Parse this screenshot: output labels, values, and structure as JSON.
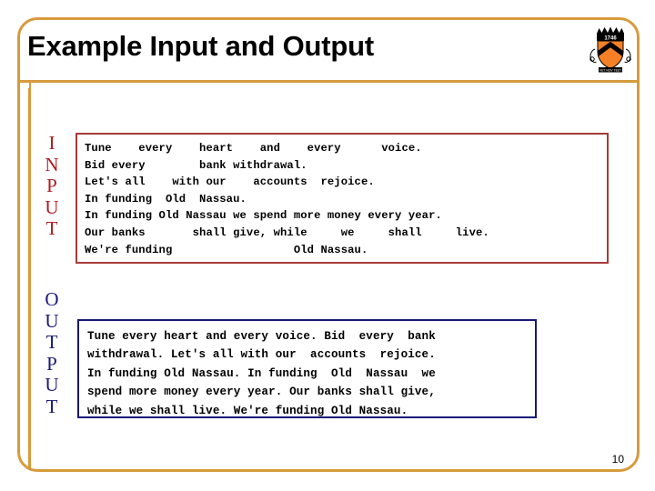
{
  "slide": {
    "title": "Example Input and Output",
    "page_number": "10",
    "frame_color": "#d79b3c",
    "background": "#ffffff"
  },
  "logo": {
    "name": "princeton-shield-logo",
    "shield_color": "#f58025",
    "chevron_color": "#000000",
    "crown_color": "#000000",
    "motto": "VET NOV TEST"
  },
  "input_section": {
    "label_color": "#b01c21",
    "label_letters": [
      "I",
      "N",
      "P",
      "U",
      "T"
    ],
    "box_border_color": "#a83a3a",
    "lines": [
      "Tune    every    heart    and    every      voice.",
      "Bid every        bank withdrawal.",
      "Let's all    with our    accounts  rejoice.",
      "In funding  Old  Nassau.",
      "In funding Old Nassau we spend more money every year.",
      "Our banks       shall give, while     we     shall     live.",
      "We're funding                  Old Nassau."
    ],
    "justified_lines": [
      {
        "text": "Tune every heart and every voice.",
        "justify": true
      },
      {
        "text": "Bid every bank withdrawal.",
        "justify": false
      },
      {
        "text": "Let's all with our accounts rejoice.",
        "justify": false
      },
      {
        "text": "In funding Old Nassau.",
        "justify": false
      },
      {
        "text": "In funding Old Nassau we spend more money every year.",
        "justify": false
      },
      {
        "text": "Our banks shall give, while we shall live.",
        "justify": true
      },
      {
        "text": "We're funding Old Nassau.",
        "justify": false
      }
    ]
  },
  "output_section": {
    "label_color": "#1a1a7a",
    "label_letters": [
      "O",
      "U",
      "T",
      "P",
      "U",
      "T"
    ],
    "box_border_color": "#181878",
    "lines": [
      "Tune every heart and every voice. Bid  every  bank",
      "withdrawal. Let's all with our  accounts  rejoice.",
      "In funding Old Nassau. In funding  Old  Nassau  we",
      "spend more money every year. Our banks shall give,",
      "while we shall live. We're funding Old Nassau."
    ],
    "full_text": "Tune every heart and every voice. Bid every bank withdrawal. Let's all with our accounts rejoice. In funding Old Nassau. In funding Old Nassau we spend more money every year. Our banks shall give, while we shall live. We're funding Old Nassau."
  }
}
